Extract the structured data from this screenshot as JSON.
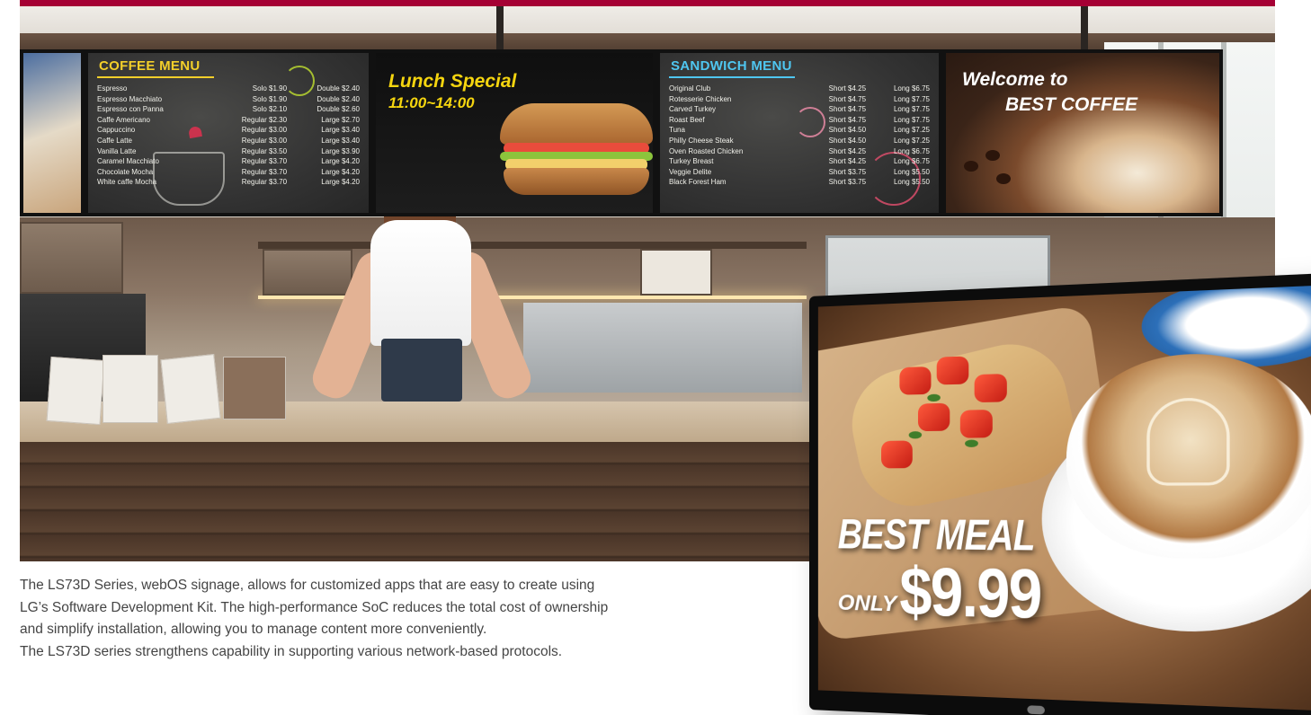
{
  "coffee_menu": {
    "title": "COFFEE MENU",
    "items": [
      {
        "name": "Espresso",
        "small": "Solo $1.90",
        "large": "Double $2.40"
      },
      {
        "name": "Espresso Macchiato",
        "small": "Solo $1.90",
        "large": "Double $2.40"
      },
      {
        "name": "Espresso con Panna",
        "small": "Solo $2.10",
        "large": "Double $2.60"
      },
      {
        "name": "Caffe Americano",
        "small": "Regular $2.30",
        "large": "Large $2.70"
      },
      {
        "name": "Cappuccino",
        "small": "Regular $3.00",
        "large": "Large $3.40"
      },
      {
        "name": "Caffe Latte",
        "small": "Regular $3.00",
        "large": "Large $3.40"
      },
      {
        "name": "Vanilla Latte",
        "small": "Regular $3.50",
        "large": "Large $3.90"
      },
      {
        "name": "Caramel Macchiato",
        "small": "Regular $3.70",
        "large": "Large $4.20"
      },
      {
        "name": "Chocolate Mocha",
        "small": "Regular $3.70",
        "large": "Large $4.20"
      },
      {
        "name": "White caffe Mocha",
        "small": "Regular $3.70",
        "large": "Large $4.20"
      }
    ]
  },
  "lunch_special": {
    "title": "Lunch Special",
    "time": "11:00~14:00"
  },
  "sandwich_menu": {
    "title": "SANDWICH MENU",
    "items": [
      {
        "name": "Original Club",
        "short": "Short $4.25",
        "long": "Long $6.75"
      },
      {
        "name": "Rotesserie Chicken",
        "short": "Short $4.75",
        "long": "Long $7.75"
      },
      {
        "name": "Carved Turkey",
        "short": "Short $4.75",
        "long": "Long $7.75"
      },
      {
        "name": "Roast Beef",
        "short": "Short $4.75",
        "long": "Long $7.75"
      },
      {
        "name": "Tuna",
        "short": "Short $4.50",
        "long": "Long $7.25"
      },
      {
        "name": "Philly Cheese Steak",
        "short": "Short $4.50",
        "long": "Long $7.25"
      },
      {
        "name": "Oven Roasted Chicken",
        "short": "Short $4.25",
        "long": "Long $6.75"
      },
      {
        "name": "Turkey Breast",
        "short": "Short $4.25",
        "long": "Long $6.75"
      },
      {
        "name": "Veggie Delite",
        "short": "Short $3.75",
        "long": "Long $5.50"
      },
      {
        "name": "Black Forest Ham",
        "short": "Short $3.75",
        "long": "Long $5.50"
      }
    ]
  },
  "welcome": {
    "line1": "Welcome to",
    "line2": "BEST COFFEE"
  },
  "promo": {
    "headline": "BEST MEAL",
    "only": "ONLY",
    "price": "$9.99"
  },
  "description": {
    "lines": [
      "The LS73D Series, webOS signage, allows for customized apps that are easy to create using",
      "LG’s Software Development Kit. The high-performance SoC reduces the total cost of ownership",
      "and simplify installation, allowing you to manage content more conveniently.",
      "The LS73D series strengthens capability in supporting various network-based protocols."
    ]
  },
  "colors": {
    "brand_stripe": "#a50034",
    "coffee_title": "#f3cf2a",
    "sandwich_title": "#4fc6f0",
    "lunch_text": "#f5d50f"
  }
}
